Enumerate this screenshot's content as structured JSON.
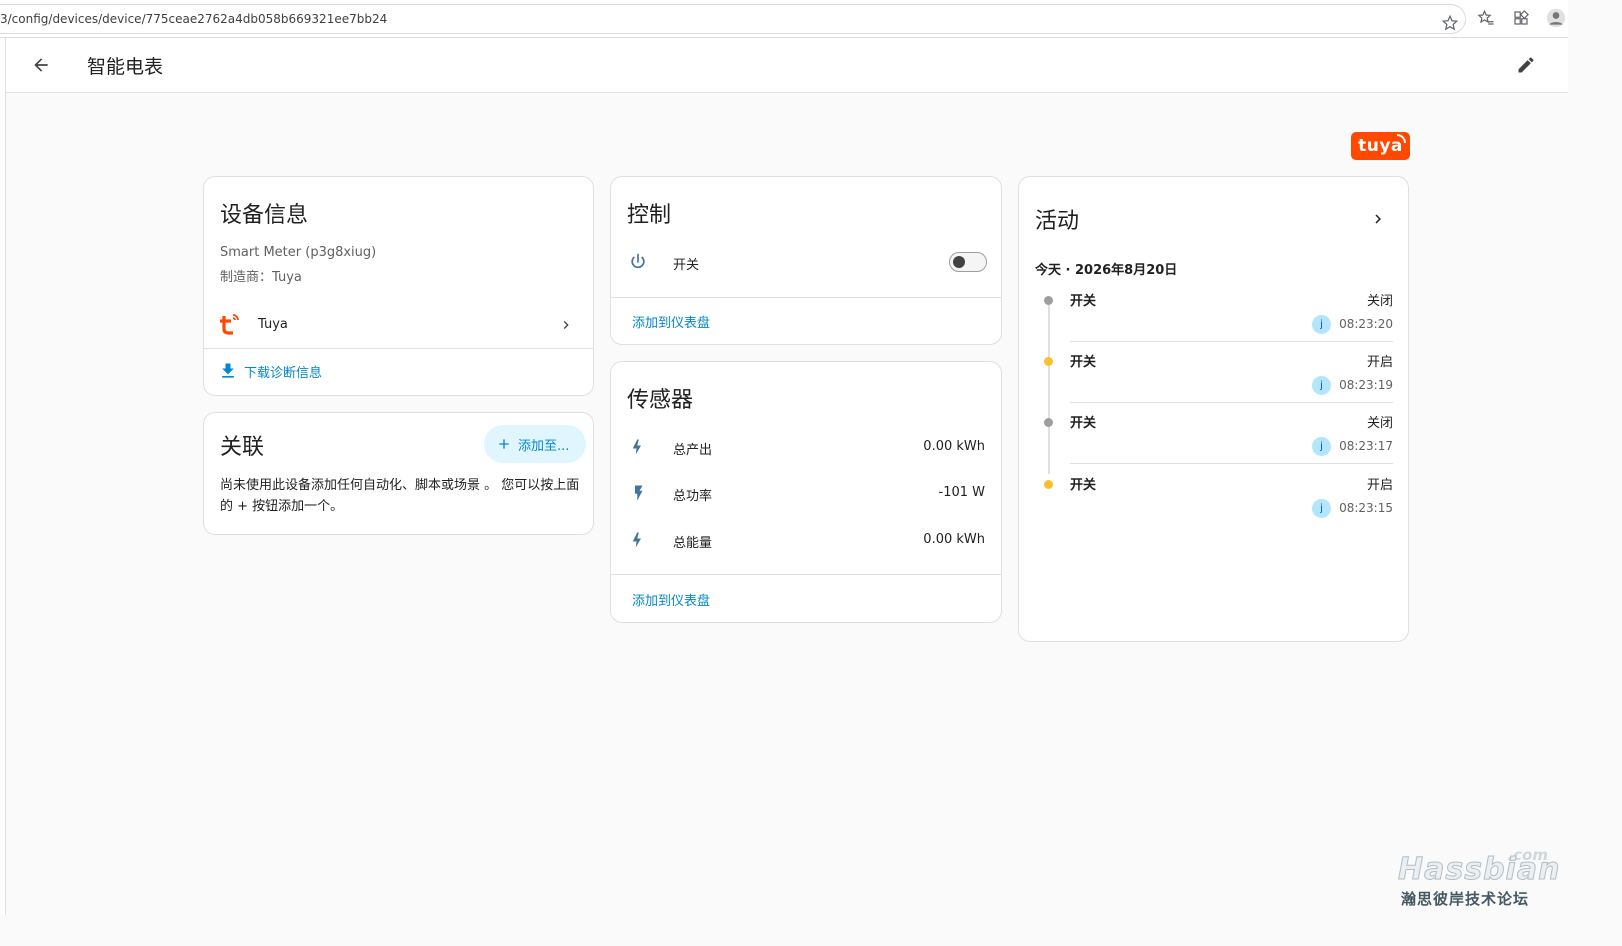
{
  "browser": {
    "url": "3/config/devices/device/775ceae2762a4db058b669321ee7bb24"
  },
  "header": {
    "title": "智能电表"
  },
  "brand": {
    "logo_text": "tuya",
    "color": "#ff4800"
  },
  "device_info": {
    "title": "设备信息",
    "model": "Smart Meter (p3g8xiug)",
    "manufacturer": "制造商：Tuya",
    "integration": "Tuya",
    "download_label": "下载诊断信息"
  },
  "related": {
    "title": "关联",
    "add_label": "添加至...",
    "description": "尚未使用此设备添加任何自动化、脚本或场景 。 您可以按上面的 + 按钮添加一个。"
  },
  "control": {
    "title": "控制",
    "switch_label": "开关",
    "switch_on": false,
    "add_dashboard": "添加到仪表盘"
  },
  "sensors": {
    "title": "传感器",
    "items": [
      {
        "label": "总产出",
        "value": "0.00 kWh"
      },
      {
        "label": "总功率",
        "value": "-101 W"
      },
      {
        "label": "总能量",
        "value": "0.00 kWh"
      }
    ],
    "add_dashboard": "添加到仪表盘"
  },
  "activity": {
    "title": "活动",
    "date": "今天 · 2026年8月20日",
    "entries": [
      {
        "name": "开关",
        "state": "关闭",
        "time": "08:23:20",
        "avatar": "j",
        "dot_color": "#9e9e9e"
      },
      {
        "name": "开关",
        "state": "开启",
        "time": "08:23:19",
        "avatar": "j",
        "dot_color": "#fdd835"
      },
      {
        "name": "开关",
        "state": "关闭",
        "time": "08:23:17",
        "avatar": "j",
        "dot_color": "#9e9e9e"
      },
      {
        "name": "开关",
        "state": "开启",
        "time": "08:23:15",
        "avatar": "j",
        "dot_color": "#fdd835"
      }
    ]
  },
  "watermark": {
    "com": ".com",
    "main": "Hassbian",
    "sub": "瀚思彼岸技术论坛"
  }
}
